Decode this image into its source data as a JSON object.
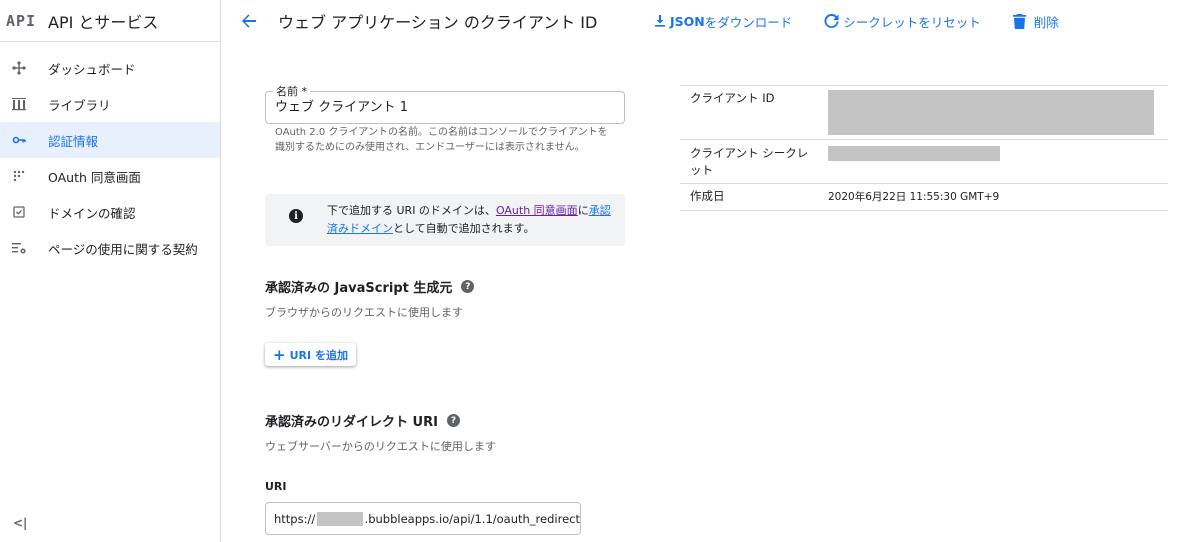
{
  "sidebar": {
    "logo": "API",
    "title": "API とサービス",
    "items": [
      {
        "label": "ダッシュボード",
        "icon": "dashboard-icon"
      },
      {
        "label": "ライブラリ",
        "icon": "library-icon"
      },
      {
        "label": "認証情報",
        "icon": "key-icon",
        "active": true
      },
      {
        "label": "OAuth 同意画面",
        "icon": "consent-icon"
      },
      {
        "label": "ドメインの確認",
        "icon": "domain-check-icon"
      },
      {
        "label": "ページの使用に関する契約",
        "icon": "settings-list-icon"
      }
    ],
    "collapse": "<|"
  },
  "header": {
    "title": "ウェブ アプリケーション のクライアント ID",
    "download_bold": "JSON",
    "download_rest": " をダウンロード",
    "reset": "シークレットをリセット",
    "delete": "削除"
  },
  "form": {
    "name_label": "名前 *",
    "name_value": "ウェブ クライアント 1",
    "name_hint": "OAuth 2.0 クライアントの名前。この名前はコンソールでクライアントを識別するためにのみ使用され、エンドユーザーには表示されません。",
    "notice_pre": "下で追加する URI のドメインは、",
    "notice_link1": "OAuth 同意画面",
    "notice_mid": "に",
    "notice_link2": "承認済みドメイン",
    "notice_post": "として自動で追加されます。",
    "js_title": "承認済みの JavaScript 生成元",
    "js_sub": "ブラウザからのリクエストに使用します",
    "add_uri": "URI を追加",
    "redirect_title": "承認済みのリダイレクト URI",
    "redirect_sub": "ウェブサーバーからのリクエストに使用します",
    "uri_label": "URI",
    "uri_prefix": "https://",
    "uri_suffix": ".bubbleapps.io/api/1.1/oauth_redirect"
  },
  "info": {
    "client_id_label": "クライアント ID",
    "client_secret_label": "クライアント シークレット",
    "created_label": "作成日",
    "created_value": "2020年6月22日 11:55:30 GMT+9"
  },
  "colors": {
    "accent": "#1a73e8",
    "active_bg": "#e8f0fe",
    "visited_link": "#681da8",
    "redaction": "#c4c4c4"
  }
}
